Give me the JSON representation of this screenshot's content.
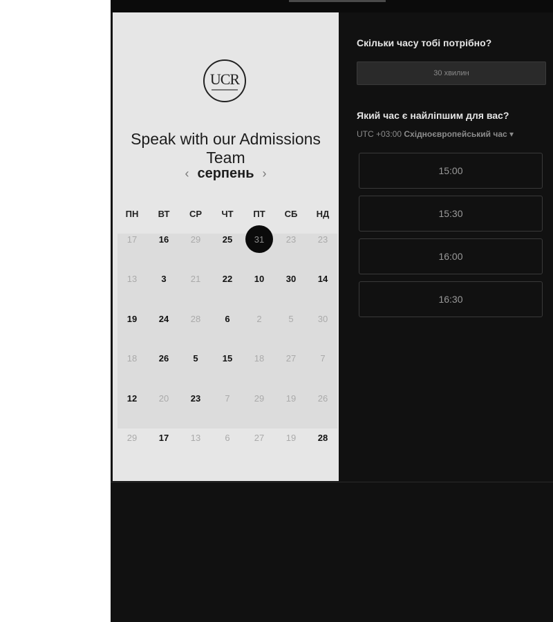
{
  "calendar": {
    "logo_text": "UCR",
    "title": "Speak with our Admissions Team",
    "month": "серпень",
    "prev_icon": "‹",
    "next_icon": "›",
    "weekdays": [
      "ПН",
      "ВТ",
      "СР",
      "ЧТ",
      "ПТ",
      "СБ",
      "НД"
    ],
    "selected_day": "31",
    "days": [
      {
        "t": "17",
        "s": "dim"
      },
      {
        "t": "16",
        "s": "avail"
      },
      {
        "t": "29",
        "s": "dim"
      },
      {
        "t": "25",
        "s": "avail"
      },
      {
        "t": "31",
        "s": "selected"
      },
      {
        "t": "23",
        "s": "dim"
      },
      {
        "t": "23",
        "s": "dim"
      },
      {
        "t": "13",
        "s": "dim"
      },
      {
        "t": "3",
        "s": "avail"
      },
      {
        "t": "21",
        "s": "dim"
      },
      {
        "t": "22",
        "s": "avail"
      },
      {
        "t": "10",
        "s": "avail"
      },
      {
        "t": "30",
        "s": "avail"
      },
      {
        "t": "14",
        "s": "avail"
      },
      {
        "t": "19",
        "s": "avail"
      },
      {
        "t": "24",
        "s": "avail"
      },
      {
        "t": "28",
        "s": "dim"
      },
      {
        "t": "6",
        "s": "avail"
      },
      {
        "t": "2",
        "s": "dim"
      },
      {
        "t": "5",
        "s": "dim"
      },
      {
        "t": "30",
        "s": "dim"
      },
      {
        "t": "18",
        "s": "dim"
      },
      {
        "t": "26",
        "s": "avail"
      },
      {
        "t": "5",
        "s": "avail"
      },
      {
        "t": "15",
        "s": "avail"
      },
      {
        "t": "18",
        "s": "dim"
      },
      {
        "t": "27",
        "s": "dim"
      },
      {
        "t": "7",
        "s": "dim"
      },
      {
        "t": "12",
        "s": "avail"
      },
      {
        "t": "20",
        "s": "dim"
      },
      {
        "t": "23",
        "s": "avail"
      },
      {
        "t": "7",
        "s": "dim"
      },
      {
        "t": "29",
        "s": "dim"
      },
      {
        "t": "19",
        "s": "dim"
      },
      {
        "t": "26",
        "s": "dim"
      },
      {
        "t": "29",
        "s": "dim"
      },
      {
        "t": "17",
        "s": "avail"
      },
      {
        "t": "13",
        "s": "dim"
      },
      {
        "t": "6",
        "s": "dim"
      },
      {
        "t": "27",
        "s": "dim"
      },
      {
        "t": "19",
        "s": "dim"
      },
      {
        "t": "28",
        "s": "avail"
      }
    ]
  },
  "booking": {
    "duration_question": "Скільки часу тобі потрібно?",
    "duration_value": "30 хвилин",
    "time_question": "Який час є найліпшим для вас?",
    "timezone_offset": "UTC +03:00",
    "timezone_name": "Східноєвропейський час",
    "timezone_caret": "▾",
    "slots": [
      "15:00",
      "15:30",
      "16:00",
      "16:30"
    ]
  },
  "colors": {
    "app_background": "#111111",
    "calendar_panel": "#e6e6e6",
    "selected_day": "#0b0b0b"
  }
}
